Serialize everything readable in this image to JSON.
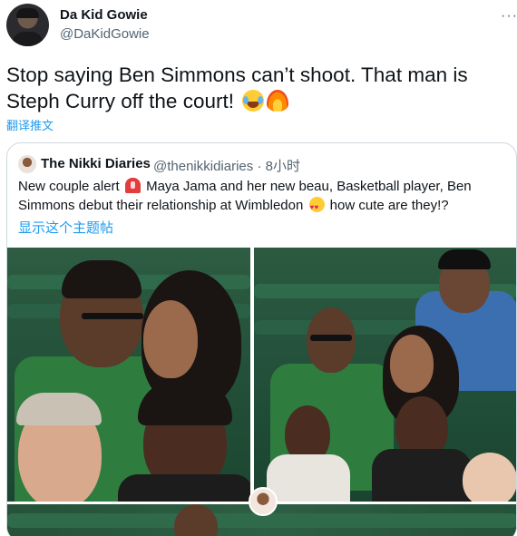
{
  "tweet": {
    "author_name": "Da Kid Gowie",
    "author_handle": "@DaKidGowie",
    "text": "Stop saying Ben Simmons can’t shoot. That man is Steph Curry off the court!",
    "emojis": [
      "face-with-tears-of-joy-emoji",
      "fire-emoji"
    ],
    "translate_label": "翻译推文",
    "more_icon": "more-icon"
  },
  "quote": {
    "author_name": "The Nikki Diaries",
    "author_handle_time": "@thenikkidiaries · 8小时",
    "text_part1": "New couple alert",
    "text_part2": "Maya Jama and her new beau, Basketball player, Ben Simmons debut their relationship at Wimbledon",
    "text_part3": "how cute are they!?",
    "emojis": [
      "police-light-emoji",
      "heart-eyes-emoji"
    ],
    "show_thread_label": "显示这个主题帖"
  },
  "colors": {
    "link": "#1d9bf0",
    "secondary_text": "#536471",
    "primary_text": "#0f1419",
    "border": "#cfd9de"
  }
}
